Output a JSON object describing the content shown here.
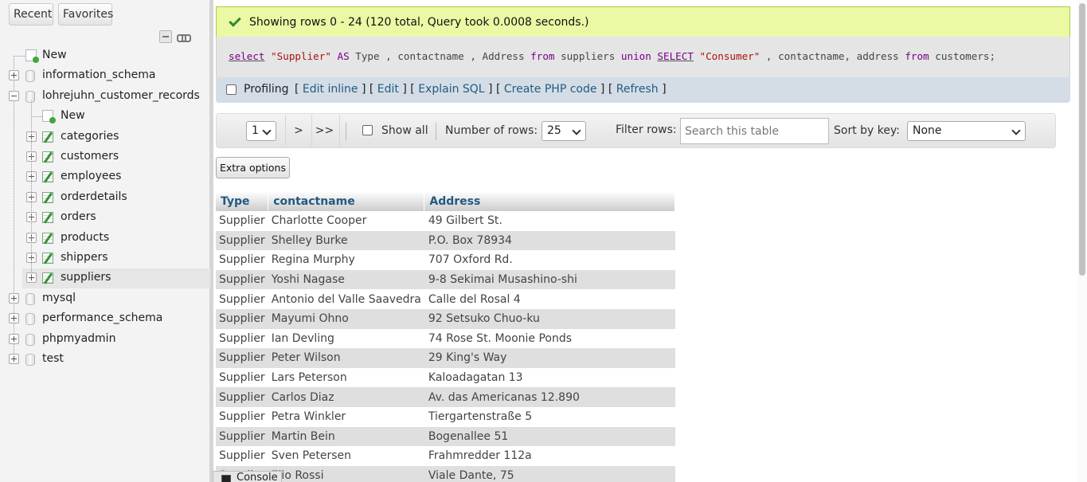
{
  "navigation": {
    "tabs": {
      "recent": "Recent",
      "favorites": "Favorites"
    },
    "tree": {
      "new_label": "New",
      "databases": [
        {
          "name": "information_schema"
        },
        {
          "name": "lohrejuhn_customer_records",
          "new_label": "New",
          "tables": [
            "categories",
            "customers",
            "employees",
            "orderdetails",
            "orders",
            "products",
            "shippers",
            "suppliers"
          ],
          "selected_table": "suppliers"
        },
        {
          "name": "mysql"
        },
        {
          "name": "performance_schema"
        },
        {
          "name": "phpmyadmin"
        },
        {
          "name": "test"
        }
      ]
    }
  },
  "result_message": "Showing rows 0 - 24 (120 total, Query took 0.0008 seconds.)",
  "sql": {
    "tokens": [
      {
        "t": "select",
        "c": "kw u"
      },
      {
        "t": " ",
        "c": ""
      },
      {
        "t": "\"Supplier\"",
        "c": "str"
      },
      {
        "t": " ",
        "c": ""
      },
      {
        "t": "AS",
        "c": "kw"
      },
      {
        "t": " Type , contactname , Address ",
        "c": ""
      },
      {
        "t": "from",
        "c": "kw"
      },
      {
        "t": " suppliers ",
        "c": ""
      },
      {
        "t": "union",
        "c": "kw"
      },
      {
        "t": " ",
        "c": ""
      },
      {
        "t": "SELECT",
        "c": "kw u"
      },
      {
        "t": " ",
        "c": ""
      },
      {
        "t": "\"Consumer\"",
        "c": "str"
      },
      {
        "t": " , contactname, address ",
        "c": ""
      },
      {
        "t": "from",
        "c": "kw"
      },
      {
        "t": " customers;",
        "c": ""
      }
    ]
  },
  "profiling": {
    "label": "Profiling",
    "links": [
      "Edit inline",
      "Edit",
      "Explain SQL",
      "Create PHP code",
      "Refresh"
    ]
  },
  "navbar": {
    "page_value": "1",
    "next": ">",
    "last": ">>",
    "show_all_label": "Show all",
    "rows_label": "Number of rows:",
    "rows_value": "25",
    "filter_label": "Filter rows:",
    "filter_placeholder": "Search this table",
    "sort_label": "Sort by key:",
    "sort_value": "None"
  },
  "extra_options_label": "Extra options",
  "table": {
    "headers": [
      "Type",
      "contactname",
      "Address"
    ],
    "rows": [
      [
        "Supplier",
        "Charlotte Cooper",
        "49 Gilbert St."
      ],
      [
        "Supplier",
        "Shelley Burke",
        "P.O. Box 78934"
      ],
      [
        "Supplier",
        "Regina Murphy",
        "707 Oxford Rd."
      ],
      [
        "Supplier",
        "Yoshi Nagase",
        "9-8 Sekimai Musashino-shi"
      ],
      [
        "Supplier",
        "Antonio del Valle Saavedra",
        "Calle del Rosal 4"
      ],
      [
        "Supplier",
        "Mayumi Ohno",
        "92 Setsuko Chuo-ku"
      ],
      [
        "Supplier",
        "Ian Devling",
        "74 Rose St. Moonie Ponds"
      ],
      [
        "Supplier",
        "Peter Wilson",
        "29 King's Way"
      ],
      [
        "Supplier",
        "Lars Peterson",
        "Kaloadagatan 13"
      ],
      [
        "Supplier",
        "Carlos Diaz",
        "Av. das Americanas 12.890"
      ],
      [
        "Supplier",
        "Petra Winkler",
        "Tiergartenstraße 5"
      ],
      [
        "Supplier",
        "Martin Bein",
        "Bogenallee 51"
      ],
      [
        "Supplier",
        "Sven Petersen",
        "Frahmredder 112a"
      ],
      [
        "Supplier",
        "Elio Rossi",
        "Viale Dante, 75"
      ]
    ]
  },
  "console_label": "Console"
}
